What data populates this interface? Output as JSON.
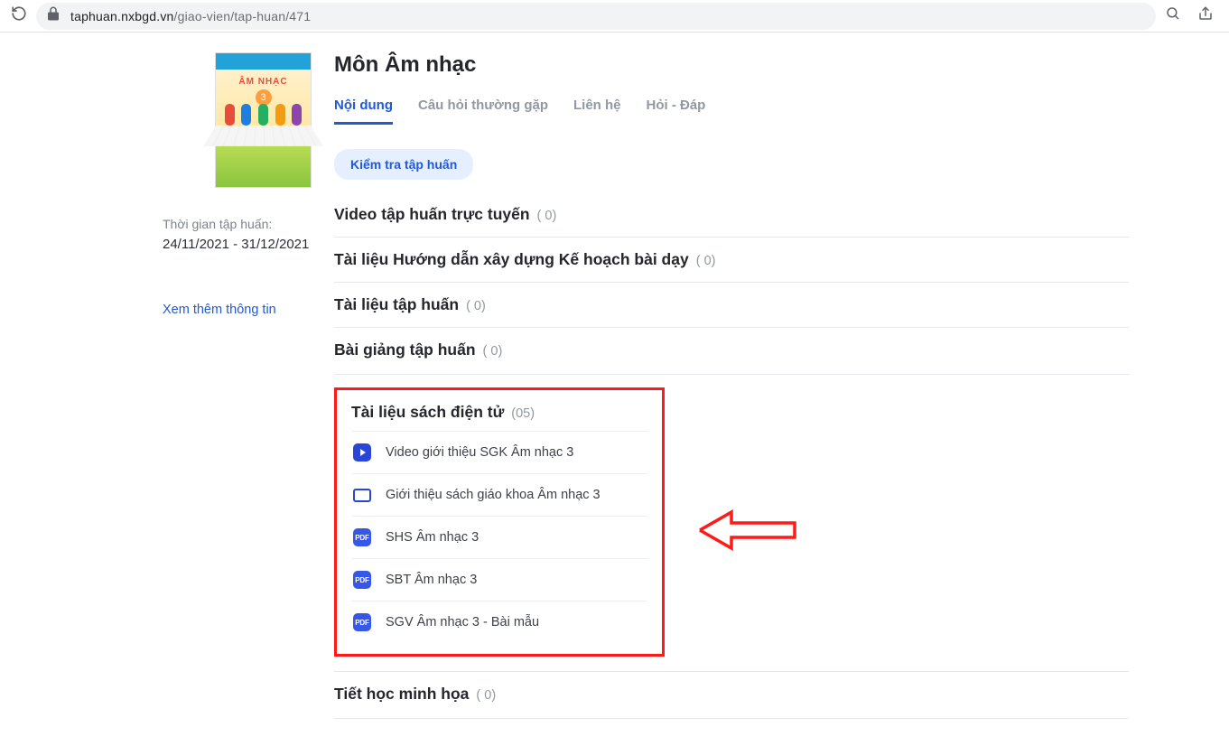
{
  "browser": {
    "url_domain": "taphuan.nxbgd.vn",
    "url_path": "/giao-vien/tap-huan/471"
  },
  "sidebar": {
    "cover_title": "ÂM NHẠC",
    "cover_grade": "3",
    "time_label": "Thời gian tập huấn:",
    "time_value": "24/11/2021 - 31/12/2021",
    "more_link": "Xem thêm thông tin"
  },
  "page": {
    "title": "Môn Âm nhạc",
    "tabs": [
      {
        "label": "Nội dung",
        "active": true
      },
      {
        "label": "Câu hỏi thường gặp",
        "active": false
      },
      {
        "label": "Liên hệ",
        "active": false
      },
      {
        "label": "Hỏi - Đáp",
        "active": false
      }
    ],
    "chip_label": "Kiểm tra tập huấn"
  },
  "sections": [
    {
      "title": "Video tập huấn trực tuyến",
      "count": "( 0)"
    },
    {
      "title": "Tài liệu Hướng dẫn xây dựng Kế hoạch bài dạy",
      "count": "( 0)"
    },
    {
      "title": "Tài liệu tập huấn",
      "count": "( 0)"
    },
    {
      "title": "Bài giảng tập huấn",
      "count": "( 0)"
    }
  ],
  "ebook_section": {
    "title": "Tài liệu sách điện tử",
    "count": "(05)",
    "items": [
      {
        "type": "video",
        "label": "Video giới thiệu SGK Âm nhạc 3"
      },
      {
        "type": "screen",
        "label": "Giới thiệu sách giáo khoa Âm nhạc 3"
      },
      {
        "type": "pdf",
        "label": "SHS Âm nhạc 3"
      },
      {
        "type": "pdf",
        "label": "SBT Âm nhạc 3"
      },
      {
        "type": "pdf",
        "label": "SGV Âm nhạc 3 - Bài mẫu"
      }
    ]
  },
  "pdf_badge": "PDF",
  "last_section": {
    "title": "Tiết học minh họa",
    "count": "( 0)"
  }
}
